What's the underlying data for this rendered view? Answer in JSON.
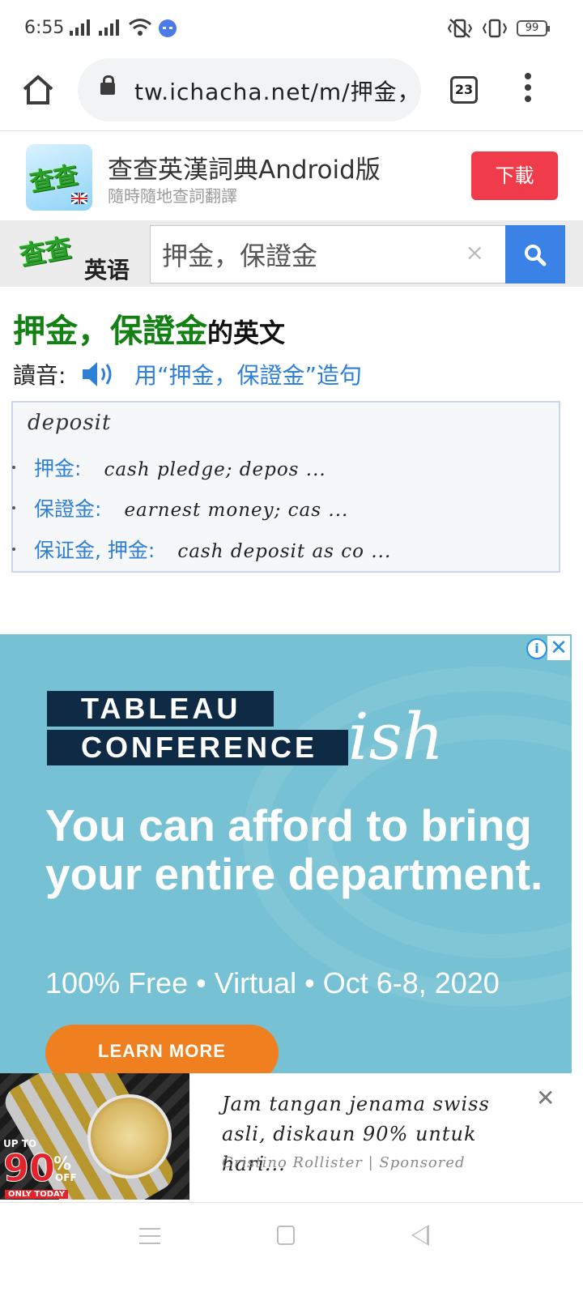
{
  "status_bar": {
    "time": "6:55",
    "battery": "99"
  },
  "browser": {
    "url": "tw.ichacha.net/m/押金，",
    "tab_count": "23"
  },
  "promo": {
    "title": "查查英漢詞典Android版",
    "subtitle": "隨時隨地查詞翻譯",
    "download_label": "下載",
    "logo_text": "查查",
    "accent_color": "#ef3b4a"
  },
  "search": {
    "logo_text": "查查",
    "logo_suffix": "英语",
    "value": "押金，保證金",
    "clear_glyph": "×",
    "button_color": "#3b82e6"
  },
  "result": {
    "headword": "押金，保證金",
    "headword_suffix": "的英文",
    "pron_label": "讀音:",
    "sentence_link": "用“押金，保證金”造句",
    "translation": "deposit",
    "entries": [
      {
        "term": "押金:",
        "gloss": "cash pledge; depos ..."
      },
      {
        "term": "保證金:",
        "gloss": "earnest money; cas ..."
      },
      {
        "term": "保证金, 押金:",
        "gloss": "cash deposit as co ..."
      }
    ],
    "headword_color": "#138013",
    "link_color": "#2e7fd6"
  },
  "ad": {
    "brand_line1": "TABLEAU",
    "brand_line2": "CONFERENCE",
    "brand_suffix": "ish",
    "headline": "You can afford to bring your entire department.",
    "sub": "100% Free • Virtual • Oct 6-8, 2020",
    "cta": "LEARN MORE",
    "info_glyph": "i",
    "close_glyph": "✕",
    "bg_color": "#76c2d4",
    "cta_color": "#f0801f"
  },
  "sponsored": {
    "badge_upto": "UP TO",
    "badge_num": "90",
    "badge_pct": "%",
    "badge_off": "OFF",
    "badge_today": "ONLY TODAY",
    "title": "Jam tangan jenama swiss asli, diskaun 90% untuk hari...",
    "source": "Cristino Rollister | Sponsored",
    "close_glyph": "✕"
  }
}
